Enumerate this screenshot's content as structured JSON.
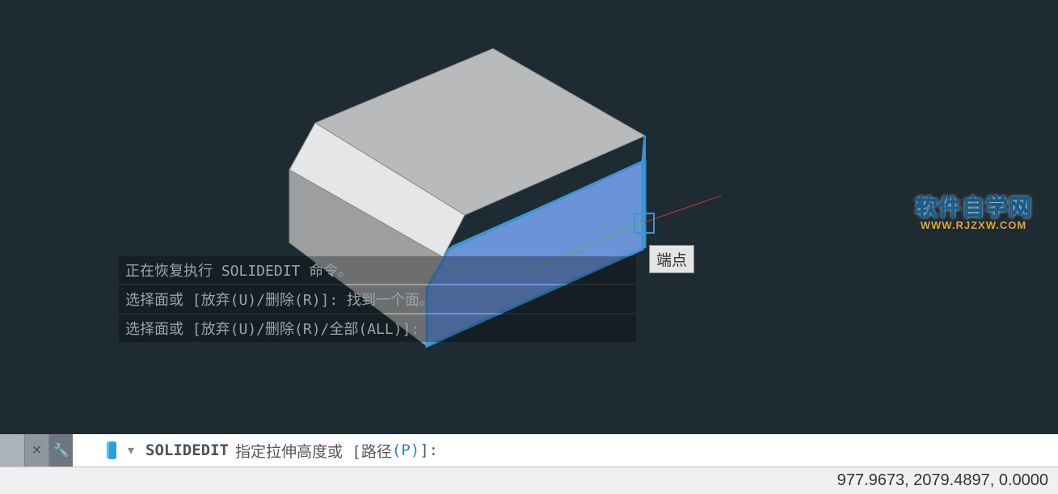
{
  "history": {
    "line1": "正在恢复执行 SOLIDEDIT 命令。",
    "line2": "选择面或 [放弃(U)/删除(R)]: 找到一个面。",
    "line3": "选择面或 [放弃(U)/删除(R)/全部(ALL)]:"
  },
  "command": {
    "name": "SOLIDEDIT",
    "prompt_prefix": "指定拉伸高度或 [",
    "path_label": "路径",
    "path_hotkey": "(P)",
    "prompt_suffix": "]:"
  },
  "status": {
    "coords": "977.9673, 2079.4897, 0.0000"
  },
  "tooltip": {
    "label": "端点"
  },
  "watermark": {
    "main": "软件自学网",
    "sub": "WWW.RJZXW.COM"
  },
  "icons": {
    "close": "✕",
    "wrench": "🔧",
    "cursor": "▯",
    "dropdown": "▾"
  },
  "colors": {
    "viewport_bg": "#1e2b33",
    "selected_face": "#6b93d8",
    "axis_green": "#4fba4f",
    "axis_red": "#c13838",
    "highlight_blue": "#3896d3"
  }
}
